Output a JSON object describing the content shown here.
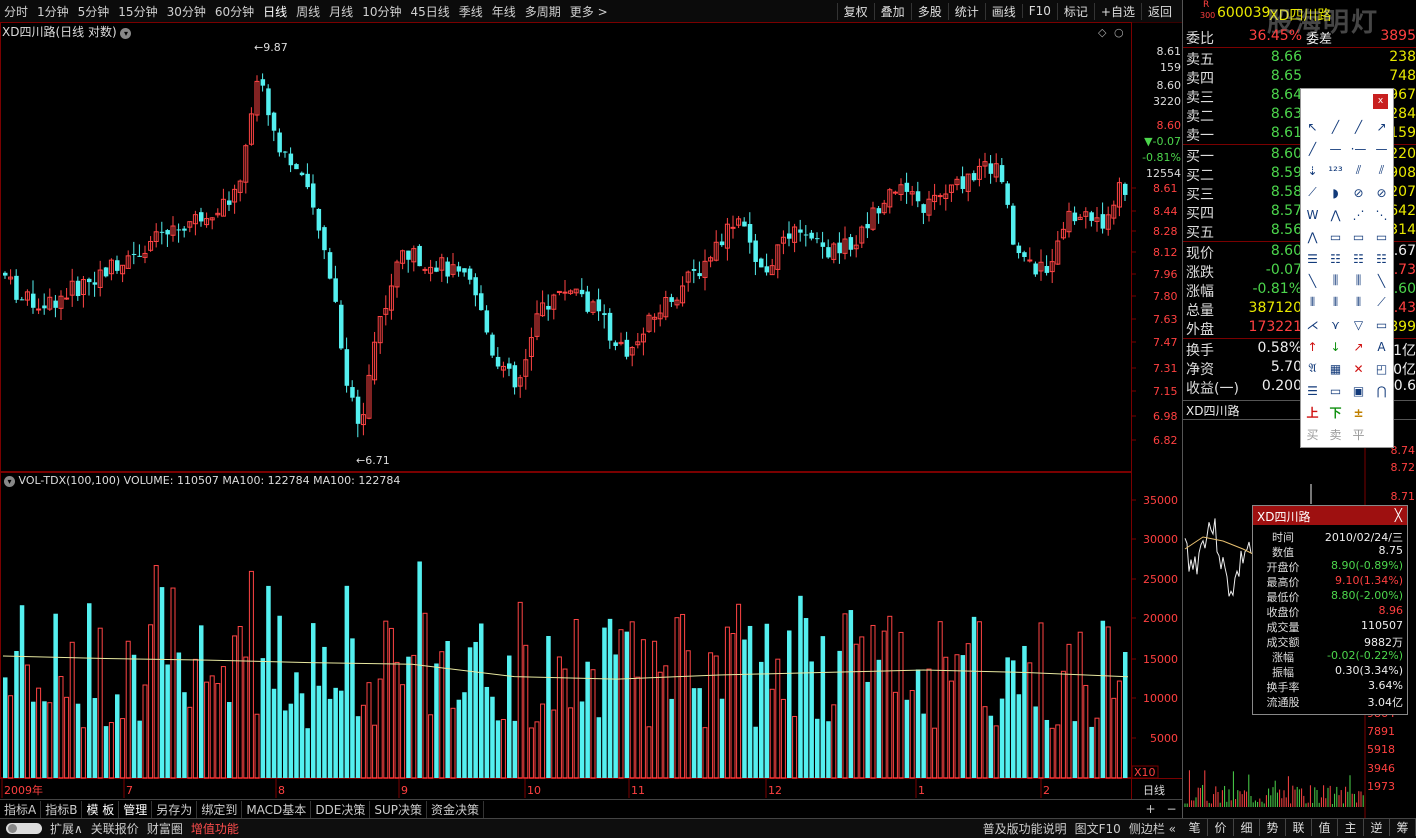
{
  "toolbar": {
    "periods": [
      "分时",
      "1分钟",
      "5分钟",
      "15分钟",
      "30分钟",
      "60分钟",
      "日线",
      "周线",
      "月线",
      "10分钟",
      "45日线",
      "季线",
      "年线",
      "多周期",
      "更多 >"
    ],
    "active_period": "日线",
    "right_buttons": [
      "复权",
      "叠加",
      "多股",
      "统计",
      "画线",
      "F10",
      "标记",
      "+自选",
      "返回"
    ]
  },
  "chart": {
    "title": "XD四川路(日线 对数)",
    "high_marker": "9.87",
    "low_marker": "6.71",
    "price_ticks": [
      "8.61",
      "8.44",
      "8.28",
      "8.12",
      "7.96",
      "7.80",
      "7.63",
      "7.47",
      "7.31",
      "7.15",
      "6.98",
      "6.82"
    ],
    "cursor_labels": [
      "8.61",
      "159",
      "8.60",
      "3220",
      "8.60",
      "▼-0.07",
      "-0.81%",
      "12554"
    ],
    "vol_title": "VOL-TDX(100,100)  VOLUME: 110507  MA100: 122784  MA100: 122784",
    "vol_ticks": [
      "35000",
      "30000",
      "25000",
      "20000",
      "15000",
      "10000",
      "5000"
    ],
    "vol_unit": "X10",
    "date_labels": [
      "2009年",
      "7",
      "8",
      "9",
      "10",
      "11",
      "12",
      "1",
      "2"
    ],
    "period_label": "日线"
  },
  "chart_data": {
    "type": "candlestick",
    "price_range": [
      6.71,
      9.87
    ],
    "volume_range": [
      0,
      37000
    ],
    "ma100_approx": [
      14800,
      14500,
      14300,
      14000,
      13800,
      12300,
      12000,
      12500,
      12800,
      13100,
      12800,
      12278
    ]
  },
  "tabs": [
    "指标A",
    "指标B",
    "模 板",
    "管理",
    "另存为",
    "绑定到",
    "MACD基本",
    "DDE决策",
    "SUP决策",
    "资金决策"
  ],
  "status": {
    "items": [
      "扩展∧",
      "关联报价",
      "财富圈",
      "增值功能"
    ],
    "right_items": [
      "普及版功能说明",
      "图文F10",
      "侧边栏 «"
    ]
  },
  "quote": {
    "r_label": "R",
    "r_num": "300",
    "code": "600039",
    "name": "XD四川路",
    "watermark": "股海明灯",
    "weibi_label": "委比",
    "weibi_pct": "36.45%",
    "weibi_diff_label": "委差",
    "weibi_diff": "3895",
    "asks": [
      {
        "label": "卖五",
        "price": "8.66",
        "vol": "238"
      },
      {
        "label": "卖四",
        "price": "8.65",
        "vol": "748"
      },
      {
        "label": "卖三",
        "price": "8.64",
        "vol": "967"
      },
      {
        "label": "卖二",
        "price": "8.63",
        "vol": "284"
      },
      {
        "label": "卖一",
        "price": "8.61",
        "vol": "159"
      }
    ],
    "bids": [
      {
        "label": "买一",
        "price": "8.60",
        "vol": "220"
      },
      {
        "label": "买二",
        "price": "8.59",
        "vol": "908"
      },
      {
        "label": "买三",
        "price": "8.58",
        "vol": "207"
      },
      {
        "label": "买四",
        "price": "8.57",
        "vol": "642"
      },
      {
        "label": "买五",
        "price": "8.56",
        "vol": "314"
      }
    ],
    "stats": [
      {
        "label": "现价",
        "value": "8.60",
        "right": "8.67"
      },
      {
        "label": "涨跌",
        "value": "-0.07",
        "right": "8.73"
      },
      {
        "label": "涨幅",
        "value": "-0.81%",
        "right": "8.60"
      },
      {
        "label": "总量",
        "value": "387120",
        "right": ".43"
      },
      {
        "label": "外盘",
        "value": "173221",
        "right": "899"
      }
    ],
    "extra": [
      {
        "label": "换手",
        "value": "0.58%",
        "right": "1亿"
      },
      {
        "label": "净资",
        "value": "5.70",
        "right": "0亿"
      },
      {
        "label": "收益(一)",
        "value": "0.200",
        "right": "0.6"
      }
    ],
    "mini_title": "XD四川路",
    "mini_ticks": [
      "8.74",
      "8.72",
      "8.71"
    ],
    "mini_vol_ticks": [
      "9864",
      "7891",
      "5918",
      "3946",
      "1973"
    ]
  },
  "palette": {
    "close": "x",
    "trade_labels": [
      "买",
      "卖",
      "平"
    ],
    "trade_icons": [
      "上",
      "下",
      "±"
    ]
  },
  "tooltip": {
    "title": "XD四川路",
    "close": "╳",
    "rows": [
      {
        "k": "时间",
        "v": "2010/02/24/三",
        "c": "white"
      },
      {
        "k": "数值",
        "v": "8.75",
        "c": "white"
      },
      {
        "k": "开盘价",
        "v": "8.90(-0.89%)",
        "c": "green"
      },
      {
        "k": "最高价",
        "v": "9.10(1.34%)",
        "c": "red"
      },
      {
        "k": "最低价",
        "v": "8.80(-2.00%)",
        "c": "green"
      },
      {
        "k": "收盘价",
        "v": "8.96",
        "c": "red"
      },
      {
        "k": "成交量",
        "v": "110507",
        "c": "white"
      },
      {
        "k": "成交额",
        "v": "9882万",
        "c": "white"
      },
      {
        "k": "涨幅",
        "v": "-0.02(-0.22%)",
        "c": "green"
      },
      {
        "k": "振幅",
        "v": "0.30(3.34%)",
        "c": "white"
      },
      {
        "k": "换手率",
        "v": "3.64%",
        "c": "white"
      },
      {
        "k": "流通股",
        "v": "3.04亿",
        "c": "white"
      }
    ]
  },
  "right_tabs": [
    "笔",
    "价",
    "细",
    "势",
    "联",
    "值",
    "主",
    "逆",
    "筹"
  ]
}
